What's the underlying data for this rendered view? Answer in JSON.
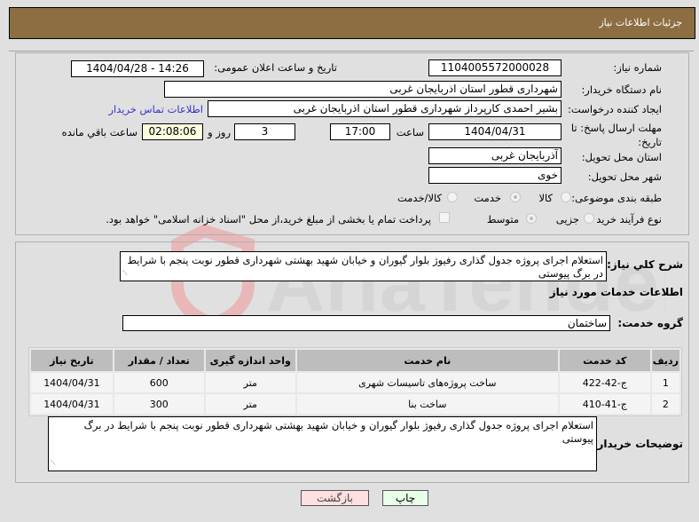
{
  "header": {
    "title": "جزئیات اطلاعات نیاز"
  },
  "form": {
    "need_number": {
      "label": "شماره نیاز:",
      "value": "1104005572000028"
    },
    "announce": {
      "label": "تاریخ و ساعت اعلان عمومی:",
      "value": "1404/04/28 - 14:26"
    },
    "buyer_org": {
      "label": "نام دستگاه خریدار:",
      "value": "شهرداری قطور استان اذربایجان غربی"
    },
    "creator": {
      "label": "ایجاد کننده درخواست:",
      "value": "بشیر احمدی کارپرداز شهرداری قطور استان اذربایجان غربی",
      "contact_link": "اطلاعات تماس خریدار"
    },
    "deadline": {
      "label": "مهلت ارسال پاسخ: تا تاریخ:",
      "date": "1404/04/31",
      "time_label": "ساعت",
      "time": "17:00",
      "days": "3",
      "days_label": "روز و",
      "remaining": "02:08:06",
      "remaining_label": "ساعت باقي مانده"
    },
    "province": {
      "label": "استان محل تحویل:",
      "value": "آذربایجان غربی"
    },
    "city": {
      "label": "شهر محل تحویل:",
      "value": "خوی"
    },
    "category": {
      "label": "طبقه بندی موضوعی:",
      "options": [
        "کالا",
        "خدمت",
        "کالا/خدمت"
      ],
      "selected": "خدمت"
    },
    "process": {
      "label": "نوع فرآیند خرید :",
      "options": [
        "جزیی",
        "متوسط"
      ],
      "selected": "متوسط",
      "payment_note": "پرداخت تمام یا بخشی از مبلغ خرید،از محل \"اسناد خزانه اسلامی\" خواهد بود."
    }
  },
  "details": {
    "summary_label": "شرح کلي نياز:",
    "summary": "استعلام اجرای پروژه جدول گذاری رفیوژ بلوار گیوران و خیابان شهید بهشتی شهرداری قطور نوبت پنجم با شرایط در برگ پیوستی",
    "services_title": "اطلاعات خدمات مورد نیاز",
    "group_label": "گروه خدمت:",
    "group_value": "ساختمان",
    "table": {
      "headers": [
        "ردیف",
        "کد خدمت",
        "نام خدمت",
        "واحد اندازه گیری",
        "تعداد / مقدار",
        "تاریخ نیاز"
      ],
      "rows": [
        [
          "1",
          "ج-42-422",
          "ساخت پروژه‌های تاسیسات شهری",
          "متر",
          "600",
          "1404/04/31"
        ],
        [
          "2",
          "ج-41-410",
          "ساخت بنا",
          "متر",
          "300",
          "1404/04/31"
        ]
      ]
    },
    "buyer_notes_label": "توضیحات خریدار:",
    "buyer_notes": "استعلام اجرای پروژه جدول گذاری رفیوژ بلوار گیوران و خیابان شهید بهشتی شهرداری قطور نوبت پنجم با شرایط در برگ پیوستی"
  },
  "buttons": {
    "print": "چاپ",
    "back": "بازگشت"
  },
  "watermark": "AriaTender.net",
  "colors": {
    "header": "#8d6e42",
    "back_button": "#ffe0e0",
    "print_button": "#e8ffe8",
    "remaining_bg": "#ffffe0",
    "link": "#3333cc"
  }
}
